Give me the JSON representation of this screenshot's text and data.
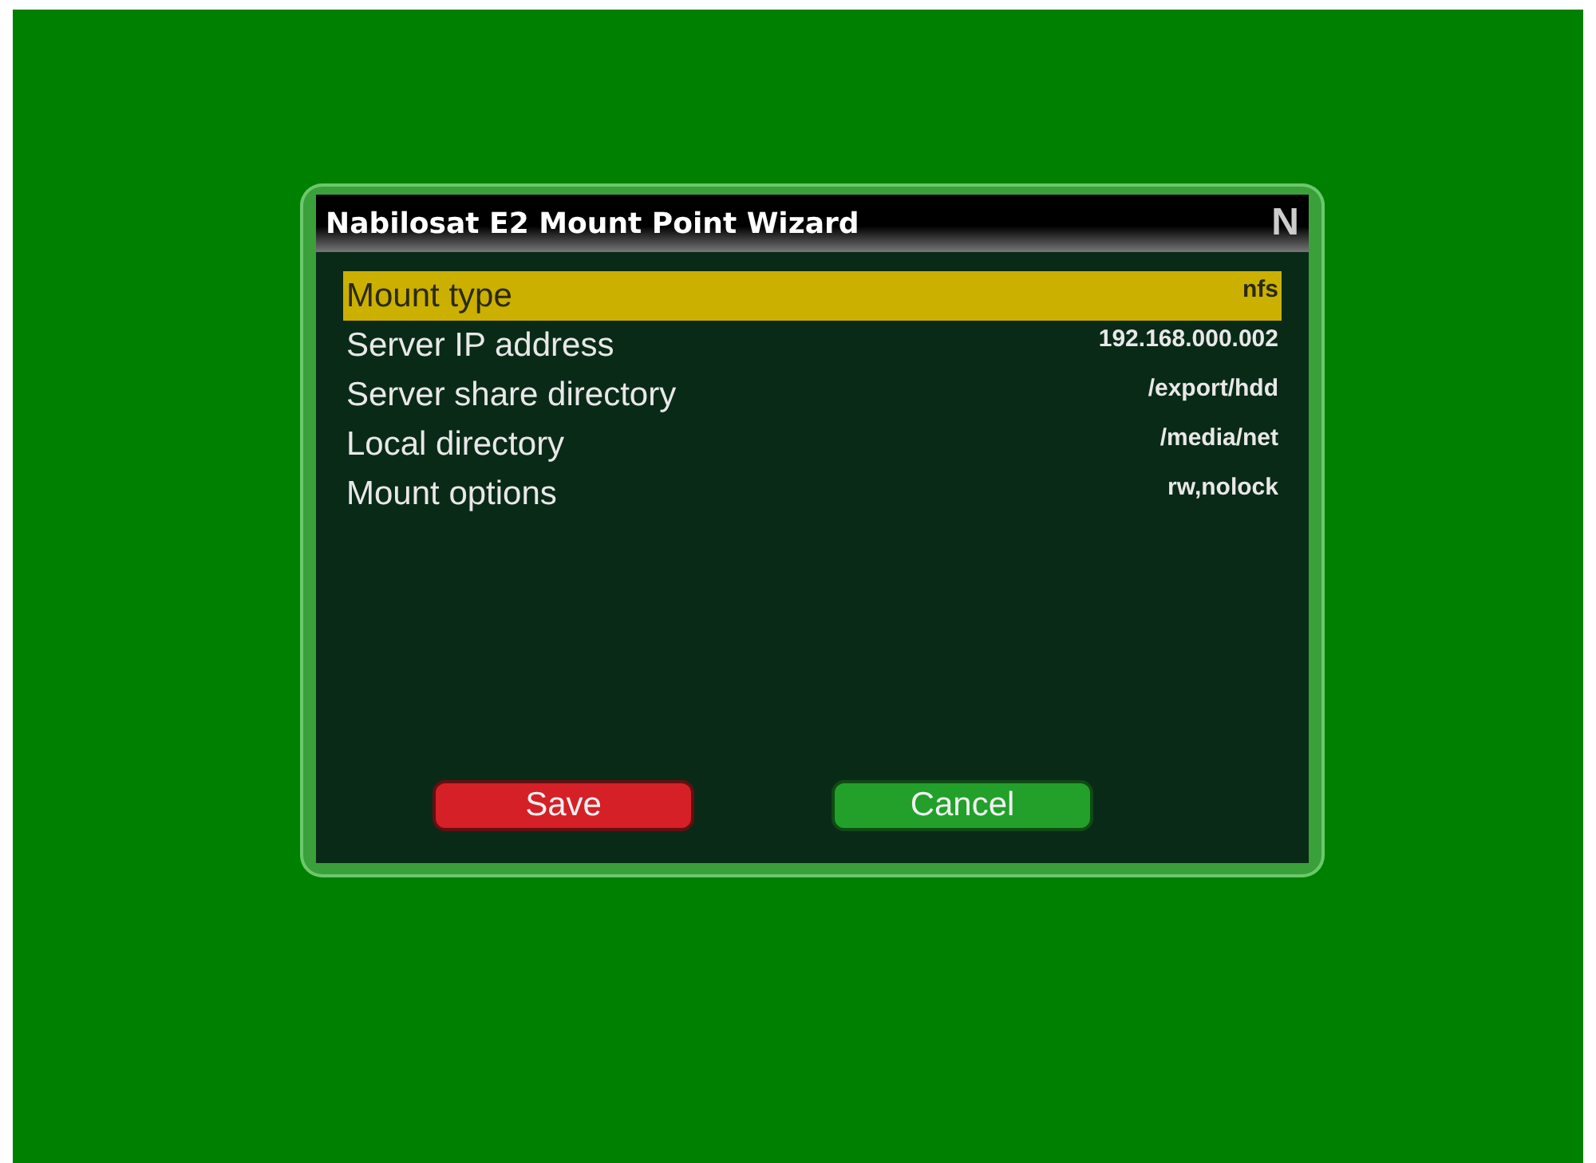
{
  "window": {
    "title": "Nabilosat E2 Mount Point Wizard",
    "logo": "N"
  },
  "settings": [
    {
      "label": "Mount type",
      "value": "nfs",
      "selected": true
    },
    {
      "label": "Server IP address",
      "value": "192.168.000.002",
      "selected": false
    },
    {
      "label": "Server share directory",
      "value": "/export/hdd",
      "selected": false
    },
    {
      "label": "Local directory",
      "value": "/media/net",
      "selected": false
    },
    {
      "label": "Mount options",
      "value": "rw,nolock",
      "selected": false
    }
  ],
  "buttons": [
    {
      "label": "Save",
      "color": "#d42026"
    },
    {
      "label": "Cancel",
      "color": "#22a02a"
    }
  ]
}
